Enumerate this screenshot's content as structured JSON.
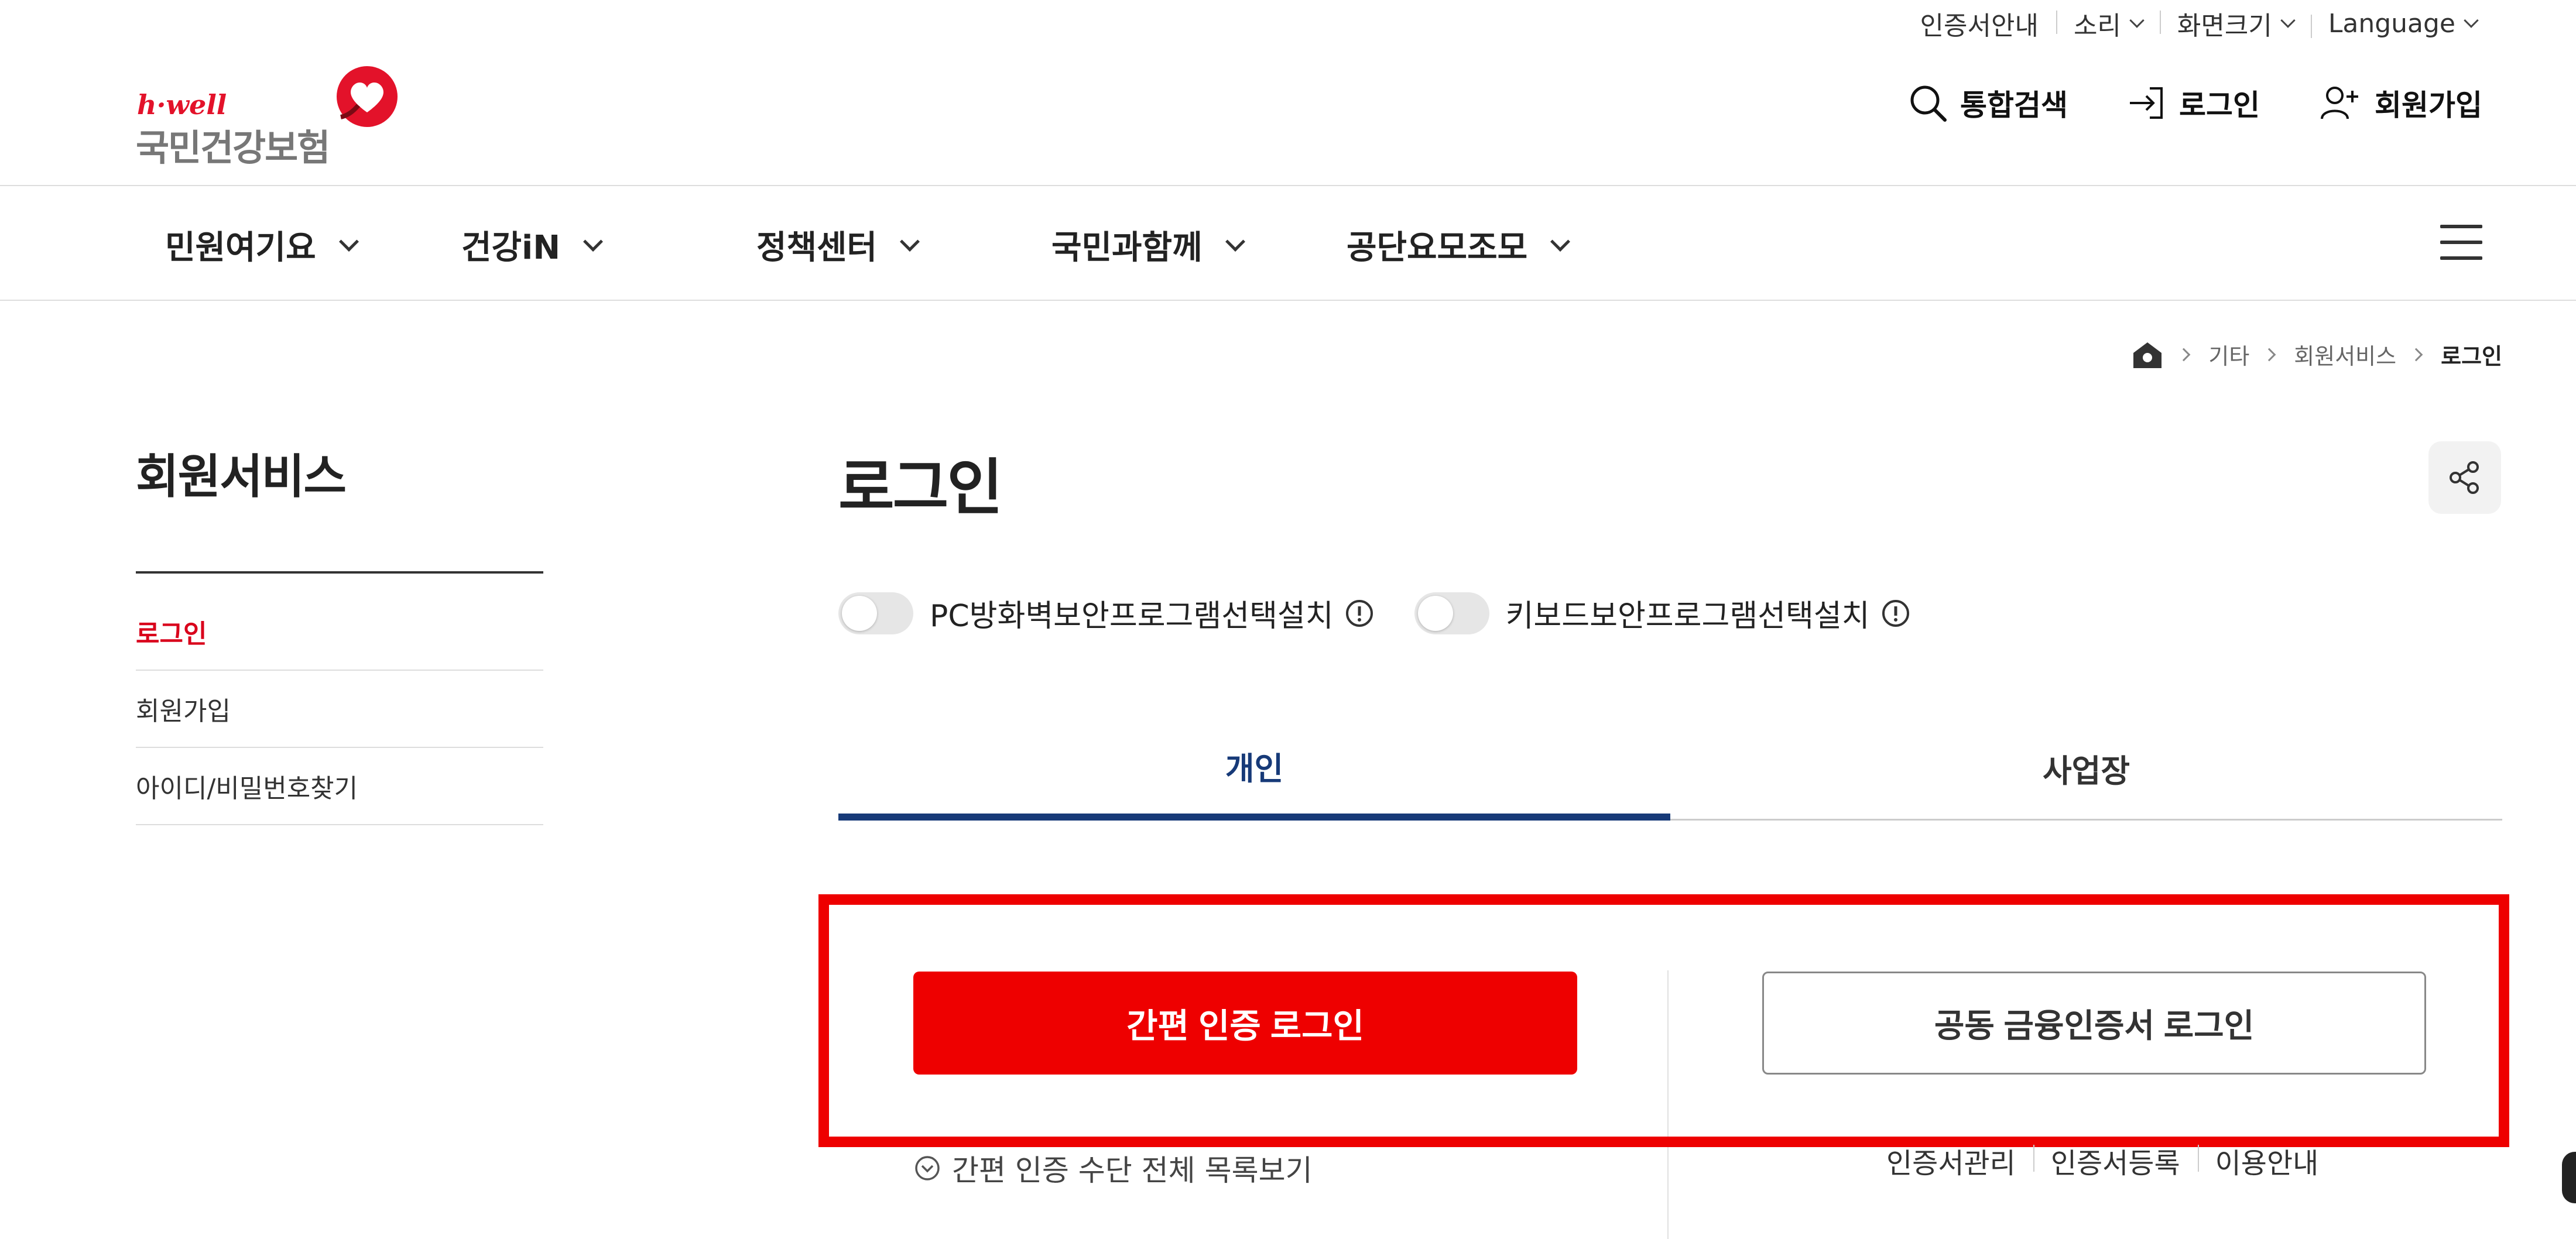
{
  "utility_bar": {
    "items": [
      {
        "label": "인증서안내",
        "has_dropdown": false
      },
      {
        "label": "소리",
        "has_dropdown": true
      },
      {
        "label": "화면크기",
        "has_dropdown": true
      },
      {
        "label": "Language",
        "has_dropdown": true
      }
    ]
  },
  "logo": {
    "tagline": "h·well",
    "name": "국민건강보험",
    "heart_color": "#e3122a"
  },
  "header": {
    "search_label": "통합검색",
    "login_label": "로그인",
    "signup_label": "회원가입"
  },
  "gnb": {
    "items": [
      {
        "label": "민원여기요",
        "icon": "chevron-down-icon"
      },
      {
        "label": "건강iN",
        "icon": "chevron-down-icon"
      },
      {
        "label": "정책센터",
        "icon": "chevron-down-icon"
      },
      {
        "label": "국민과함께",
        "icon": "chevron-down-icon"
      },
      {
        "label": "공단요모조모",
        "icon": "chevron-down-icon"
      }
    ],
    "menu_icon": "hamburger-icon"
  },
  "breadcrumb": {
    "home_icon": "home-icon",
    "items": [
      "기타",
      "회원서비스",
      "로그인"
    ]
  },
  "sidebar": {
    "title": "회원서비스",
    "items": [
      {
        "label": "로그인",
        "active": true
      },
      {
        "label": "회원가입",
        "active": false
      },
      {
        "label": "아이디/비밀번호찾기",
        "active": false
      }
    ]
  },
  "main": {
    "title": "로그인",
    "share_icon": "share-icon",
    "toggles": [
      {
        "label": "PC방화벽보안프로그램선택설치",
        "on": false
      },
      {
        "label": "키보드보안프로그램선택설치",
        "on": false
      }
    ],
    "tabs": [
      {
        "label": "개인",
        "active": true
      },
      {
        "label": "사업장",
        "active": false
      }
    ],
    "simple_login_button": "간편 인증 로그인",
    "cert_login_button": "공동 금융인증서 로그인",
    "view_all_label": "간편 인증 수단 전체 목록보기",
    "cert_links": [
      "인증서관리",
      "인증서등록",
      "이용안내"
    ]
  },
  "colors": {
    "brand_red": "#ee0000",
    "active_tab": "#173a78",
    "sidebar_active": "#d9001b"
  }
}
